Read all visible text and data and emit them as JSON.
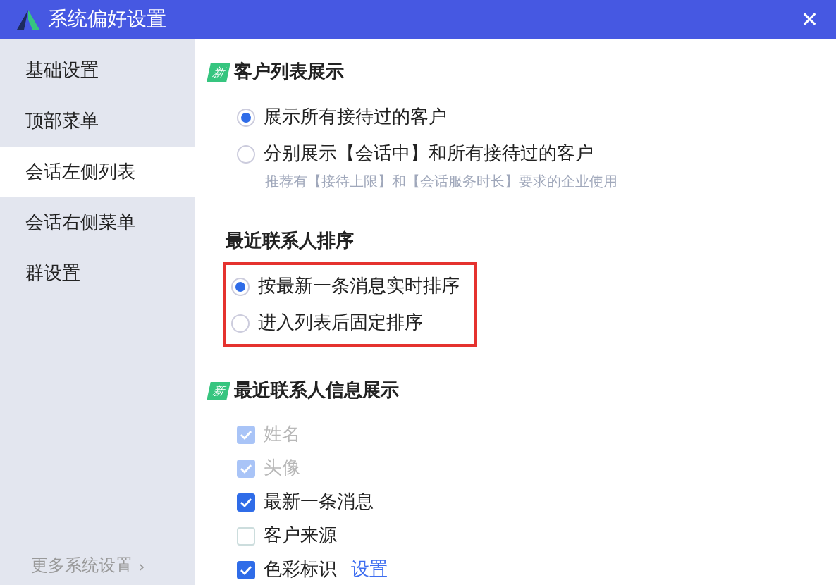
{
  "window": {
    "title": "系统偏好设置",
    "close": "✕"
  },
  "sidebar": {
    "items": [
      {
        "label": "基础设置",
        "selected": false
      },
      {
        "label": "顶部菜单",
        "selected": false
      },
      {
        "label": "会话左侧列表",
        "selected": true
      },
      {
        "label": "会话右侧菜单",
        "selected": false
      },
      {
        "label": "群设置",
        "selected": false
      }
    ],
    "more": {
      "label": "更多系统设置",
      "arrow": "›"
    }
  },
  "sections": [
    {
      "title": "客户列表展示",
      "badge": "新",
      "highlighted": false,
      "kind": "radio",
      "options": [
        {
          "label": "展示所有接待过的客户",
          "selected": true
        },
        {
          "label": "分别展示【会话中】和所有接待过的客户",
          "selected": false,
          "hint": "推荐有【接待上限】和【会话服务时长】要求的企业使用"
        }
      ]
    },
    {
      "title": "最近联系人排序",
      "highlighted": true,
      "kind": "radio",
      "options": [
        {
          "label": "按最新一条消息实时排序",
          "selected": true
        },
        {
          "label": "进入列表后固定排序",
          "selected": false
        }
      ]
    },
    {
      "title": "最近联系人信息展示",
      "badge": "新",
      "highlighted": false,
      "kind": "checkbox",
      "options": [
        {
          "label": "姓名",
          "checked": true,
          "disabled": true
        },
        {
          "label": "头像",
          "checked": true,
          "disabled": true
        },
        {
          "label": "最新一条消息",
          "checked": true,
          "disabled": false
        },
        {
          "label": "客户来源",
          "checked": false,
          "disabled": false
        },
        {
          "label": "色彩标识",
          "checked": true,
          "disabled": false,
          "link": "设置"
        }
      ]
    }
  ]
}
